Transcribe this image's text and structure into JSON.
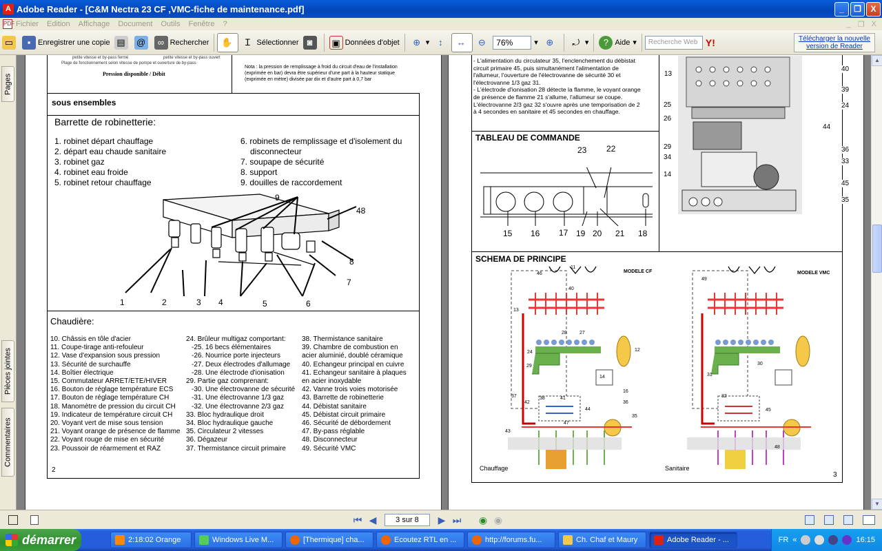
{
  "window": {
    "title": "Adobe Reader - [C&M Nectra 23 CF ,VMC-fiche de maintenance.pdf]",
    "minimize": "_",
    "maximize": "❐",
    "close": "X"
  },
  "menu": {
    "items": [
      "Fichier",
      "Edition",
      "Affichage",
      "Document",
      "Outils",
      "Fenêtre",
      "?"
    ],
    "window_controls": [
      "_",
      "❐",
      "X"
    ]
  },
  "toolbar": {
    "save_copy": "Enregistrer une copie",
    "search": "Rechercher",
    "select": "Sélectionner",
    "object_data": "Données d'objet",
    "zoom_value": "76%",
    "help": "Aide",
    "web_search_placeholder": "Recherche Web",
    "download_link_line1": "Télécharger la nouvelle",
    "download_link_line2": "version de Reader"
  },
  "side_tabs": {
    "pages": "Pages",
    "attachments": "Pièces jointes",
    "comments": "Commentaires"
  },
  "left_page": {
    "header_notes": [
      "petite vitesse et by-pass fermé",
      "petite vitesse et by-pass ouvert",
      "Plage de fonctionnement selon vitesse de pompe et ouverture de by-pass"
    ],
    "chart_caption": "Pression disponible / Débit",
    "note": "Nota : la pression de remplissage à froid du circuit d'eau de l'installation (exprimée en bar) devra être supérieur d'une part à la hauteur statique (exprimée en mètre) divisée par dix et d'autre part à 0,7 bar",
    "section_sous_ensembles": "sous ensembles",
    "barrette_title": "Barrette de robinetterie:",
    "barrette_col1": [
      "1. robinet départ chauffage",
      "2. départ eau chaude sanitaire",
      "3. robinet gaz",
      "4. robinet eau froide",
      "5. robinet retour chauffage"
    ],
    "barrette_col2": [
      "6. robinets de remplissage et d'isolement du",
      "disconnecteur",
      "7. soupape de sécurité",
      "8. support",
      "9. douilles de raccordement"
    ],
    "diagram_labels": [
      "1",
      "2",
      "3",
      "4",
      "5",
      "6",
      "7",
      "8",
      "9",
      "48"
    ],
    "chaudiere_title": "Chaudière:",
    "chaudiere_col1": [
      "10. Châssis en tôle d'acier",
      "11. Coupe-tirage anti-refouleur",
      "12. Vase d'expansion sous pression",
      "13. Sécurité de surchauffe",
      "14. Boîtier électrique",
      "15. Commutateur ARRET/ETE/HIVER",
      "16. Bouton de réglage température ECS",
      "17. Bouton de réglage température CH",
      "18. Manomètre de pression du circuit CH",
      "19. Indicateur de température circuit CH",
      "20. Voyant vert de mise sous tension",
      "21. Voyant orange de présence de flamme",
      "22. Voyant rouge de mise en sécurité",
      "23. Poussoir de réarmement et RAZ"
    ],
    "chaudiere_col2": [
      "24. Brûleur multigaz comportant:",
      "-25. 16 becs élémentaires",
      "-26. Nourrice porte injecteurs",
      "-27. Deux électrodes d'allumage",
      "-28. Une électrode d'ionisation",
      "29. Partie gaz comprenant:",
      "-30. Une électrovanne de sécurité",
      "-31. Une électrovanne 1/3 gaz",
      "-32. Une électrovanne 2/3 gaz",
      "33. Bloc hydraulique droit",
      "34. Bloc hydraulique gauche",
      "35. Circulateur 2 vitesses",
      "36. Dégazeur",
      "37. Thermistance circuit primaire"
    ],
    "chaudiere_col3": [
      "38. Thermistance sanitaire",
      "39. Chambre de combustion en",
      "acier aluminié, doublé céramique",
      "40. Echangeur principal en cuivre",
      "41. Echangeur sanitaire à plaques",
      "en acier inoxydable",
      "42. Vanne trois voies motorisée",
      "43. Barrette de robinetterie",
      "44. Débistat sanitaire",
      "45. Débistat circuit primaire",
      "46. Sécurité de débordement",
      "47. By-pass réglable",
      "48. Disconnecteur",
      "49. Sécurité VMC"
    ],
    "page_number": "2"
  },
  "right_page": {
    "intro_text": [
      "- L'alimentation du circulateur 35, l'enclenchement du débistat",
      "circuit primaire 45, puis simultanément l'alimentation de",
      "l'allumeur, l'ouverture de l'électrovanne de sécurité 30  et",
      "l'électrovanne 1/3 gaz 31.",
      "- L'électrode d'ionisation 28 détecte la flamme, le voyant orange",
      "de présence de flamme 21 s'allume, l'allumeur se coupe.",
      "L'électrovanne 2/3 gaz 32  s'ouvre après une temporisation de 2",
      "à 4 secondes en sanitaire et 45 secondes en chauffage."
    ],
    "tableau_title": "TABLEAU DE COMMANDE",
    "tableau_labels": [
      "23",
      "22",
      "15",
      "16",
      "17",
      "19",
      "20",
      "21",
      "18"
    ],
    "boiler_labels": [
      "13",
      "40",
      "39",
      "25",
      "24",
      "26",
      "44",
      "29",
      "36",
      "34",
      "33",
      "14",
      "45",
      "35"
    ],
    "schema_title": "SCHEMA DE PRINCIPE",
    "modele_cf": "MODELE CF",
    "modele_vmc": "MODELE  VMC",
    "schema_labels_cf": [
      "46",
      "11",
      "40",
      "13",
      "28",
      "27",
      "24",
      "12",
      "29",
      "14",
      "16",
      "37",
      "38",
      "41",
      "42",
      "44",
      "36",
      "35",
      "47",
      "43"
    ],
    "schema_labels_vmc": [
      "49",
      "31",
      "30",
      "32",
      "45",
      "48"
    ],
    "chauffage_label": "Chauffage",
    "sanitaire_label": "Sanitaire",
    "page_number": "3"
  },
  "navbar": {
    "page_indicator": "3 sur 8"
  },
  "taskbar": {
    "start": "démarrer",
    "tasks": [
      "2:18:02 Orange",
      "Windows Live M...",
      "[Thermique] cha...",
      "Ecoutez RTL en ...",
      "http://forums.fu...",
      "Ch. Chaf et Maury",
      "Adobe Reader - ..."
    ],
    "lang": "FR",
    "clock": "16:15"
  },
  "colors": {
    "titlebar": "#0a5cd8",
    "taskbar": "#245edb",
    "start_green": "#3a9c3a"
  }
}
